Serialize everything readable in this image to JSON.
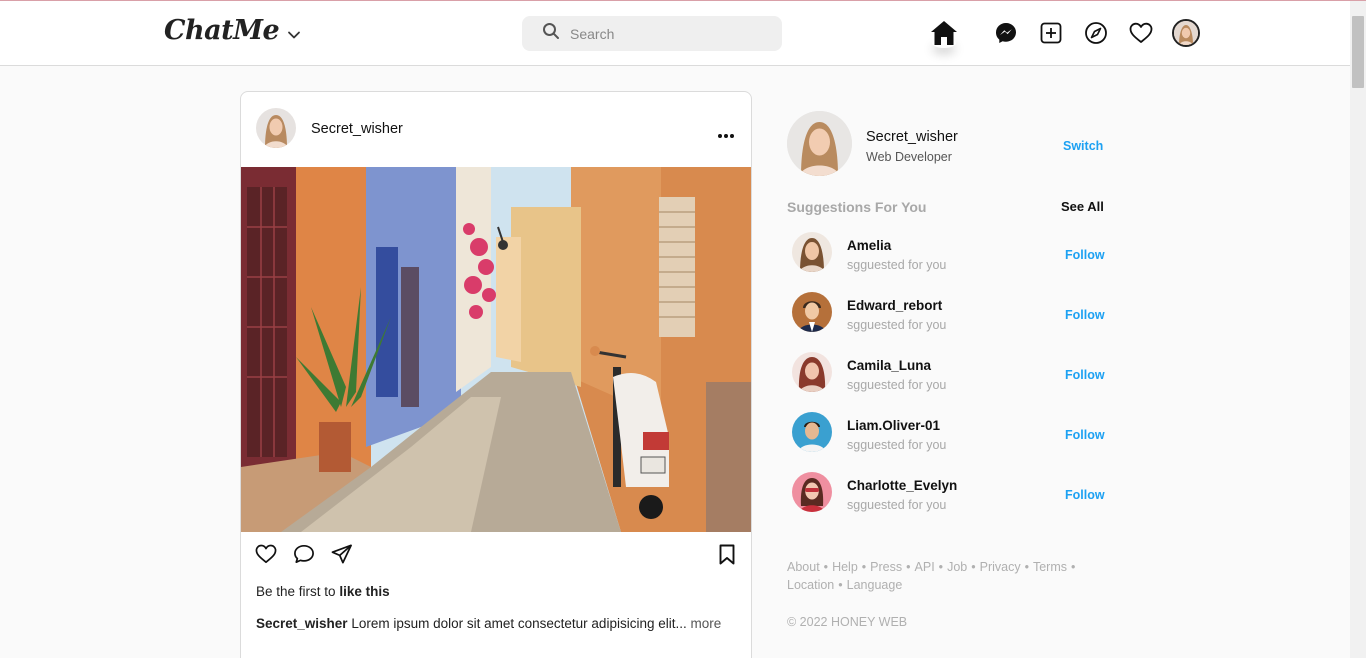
{
  "app": {
    "logo": "ChatMe"
  },
  "search": {
    "placeholder": "Search"
  },
  "nav": {
    "icons": [
      "home-icon",
      "messenger-icon",
      "add-post-icon",
      "explore-icon",
      "heart-icon",
      "profile-avatar"
    ]
  },
  "post": {
    "username": "Secret_wisher",
    "likes_prefix": "Be the first to",
    "likes_bold": "like this",
    "caption_user": "Secret_wisher",
    "caption_text": "Lorem ipsum dolor sit amet consectetur adipisicing elit...",
    "caption_more": "more"
  },
  "profile": {
    "name": "Secret_wisher",
    "role": "Web Developer",
    "switch_label": "Switch"
  },
  "suggestions": {
    "title": "Suggestions For You",
    "see_all": "See All",
    "items": [
      {
        "name": "Amelia",
        "sub": "sgguested for you",
        "action": "Follow",
        "color": "#e8c4a8"
      },
      {
        "name": "Edward_rebort",
        "sub": "sgguested for you",
        "action": "Follow",
        "color": "#b5703a"
      },
      {
        "name": "Camila_Luna",
        "sub": "sgguested for you",
        "action": "Follow",
        "color": "#c98080"
      },
      {
        "name": "Liam.Oliver-01",
        "sub": "sgguested for you",
        "action": "Follow",
        "color": "#3aa0d0"
      },
      {
        "name": "Charlotte_Evelyn",
        "sub": "sgguested for you",
        "action": "Follow",
        "color": "#e88090"
      }
    ]
  },
  "footer": {
    "links": [
      "About",
      "Help",
      "Press",
      "API",
      "Job",
      "Privacy",
      "Terms",
      "Location",
      "Language"
    ],
    "copyright": "© 2022 HONEY WEB"
  },
  "colors": {
    "accent": "#1da1f2",
    "muted": "#a8a8a8"
  }
}
